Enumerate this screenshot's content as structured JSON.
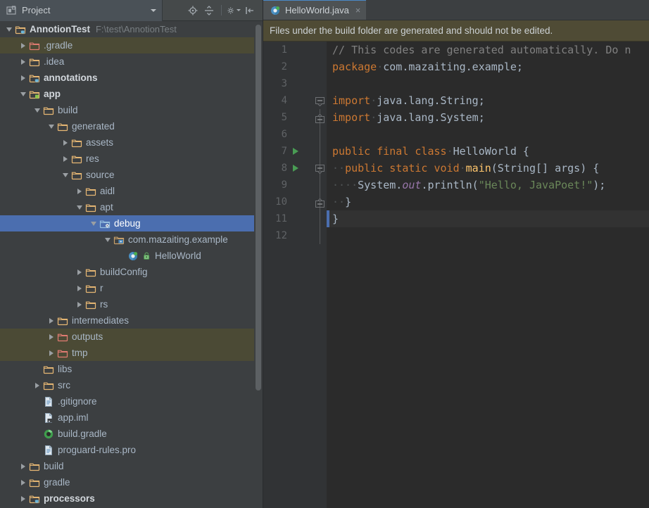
{
  "panel": {
    "title": "Project",
    "title_icon": "project-window-icon",
    "dropdown_icon": "chevron-down-icon",
    "tools": [
      {
        "name": "locate-in-tree-icon",
        "label": "Select Opened File"
      },
      {
        "name": "collapse-all-icon",
        "label": "Collapse All"
      },
      {
        "name": "settings-gear-icon",
        "label": "Settings"
      },
      {
        "name": "hide-panel-icon",
        "label": "Hide"
      }
    ]
  },
  "tree": {
    "rows": [
      {
        "depth": 0,
        "twisty": "expanded",
        "icon": "module-folder-icon",
        "label": "AnnotionTest",
        "sub": "F:\\test\\AnnotionTest",
        "bold": true,
        "state": "normal"
      },
      {
        "depth": 1,
        "twisty": "collapsed",
        "icon": "folder-red-icon",
        "label": ".gradle",
        "sub": "",
        "bold": false,
        "state": "excluded"
      },
      {
        "depth": 1,
        "twisty": "collapsed",
        "icon": "folder-icon",
        "label": ".idea",
        "sub": "",
        "bold": false,
        "state": "normal"
      },
      {
        "depth": 1,
        "twisty": "collapsed",
        "icon": "module-folder-icon",
        "label": "annotations",
        "sub": "",
        "bold": true,
        "state": "normal"
      },
      {
        "depth": 1,
        "twisty": "expanded",
        "icon": "android-module-icon",
        "label": "app",
        "sub": "",
        "bold": true,
        "state": "normal"
      },
      {
        "depth": 2,
        "twisty": "expanded",
        "icon": "folder-icon",
        "label": "build",
        "sub": "",
        "bold": false,
        "state": "normal"
      },
      {
        "depth": 3,
        "twisty": "expanded",
        "icon": "folder-icon",
        "label": "generated",
        "sub": "",
        "bold": false,
        "state": "normal"
      },
      {
        "depth": 4,
        "twisty": "collapsed",
        "icon": "folder-icon",
        "label": "assets",
        "sub": "",
        "bold": false,
        "state": "normal"
      },
      {
        "depth": 4,
        "twisty": "collapsed",
        "icon": "folder-icon",
        "label": "res",
        "sub": "",
        "bold": false,
        "state": "normal"
      },
      {
        "depth": 4,
        "twisty": "expanded",
        "icon": "folder-icon",
        "label": "source",
        "sub": "",
        "bold": false,
        "state": "normal"
      },
      {
        "depth": 5,
        "twisty": "collapsed",
        "icon": "folder-icon",
        "label": "aidl",
        "sub": "",
        "bold": false,
        "state": "normal"
      },
      {
        "depth": 5,
        "twisty": "expanded",
        "icon": "folder-icon",
        "label": "apt",
        "sub": "",
        "bold": false,
        "state": "normal"
      },
      {
        "depth": 6,
        "twisty": "expanded",
        "icon": "generated-source-folder-icon",
        "label": "debug",
        "sub": "",
        "bold": false,
        "state": "selected"
      },
      {
        "depth": 7,
        "twisty": "expanded",
        "icon": "package-icon",
        "label": "com.mazaiting.example",
        "sub": "",
        "bold": false,
        "state": "normal"
      },
      {
        "depth": 8,
        "twisty": "none",
        "icon": "java-class-icon",
        "icon2": "public-lock-icon",
        "label": "HelloWorld",
        "sub": "",
        "bold": false,
        "state": "normal"
      },
      {
        "depth": 5,
        "twisty": "collapsed",
        "icon": "folder-icon",
        "label": "buildConfig",
        "sub": "",
        "bold": false,
        "state": "normal"
      },
      {
        "depth": 5,
        "twisty": "collapsed",
        "icon": "folder-icon",
        "label": "r",
        "sub": "",
        "bold": false,
        "state": "normal"
      },
      {
        "depth": 5,
        "twisty": "collapsed",
        "icon": "folder-icon",
        "label": "rs",
        "sub": "",
        "bold": false,
        "state": "normal"
      },
      {
        "depth": 3,
        "twisty": "collapsed",
        "icon": "folder-icon",
        "label": "intermediates",
        "sub": "",
        "bold": false,
        "state": "normal"
      },
      {
        "depth": 3,
        "twisty": "collapsed",
        "icon": "folder-red-icon",
        "label": "outputs",
        "sub": "",
        "bold": false,
        "state": "excluded"
      },
      {
        "depth": 3,
        "twisty": "collapsed",
        "icon": "folder-red-icon",
        "label": "tmp",
        "sub": "",
        "bold": false,
        "state": "excluded"
      },
      {
        "depth": 2,
        "twisty": "none",
        "icon": "folder-icon",
        "label": "libs",
        "sub": "",
        "bold": false,
        "state": "normal"
      },
      {
        "depth": 2,
        "twisty": "collapsed",
        "icon": "folder-icon",
        "label": "src",
        "sub": "",
        "bold": false,
        "state": "normal"
      },
      {
        "depth": 2,
        "twisty": "none",
        "icon": "text-file-icon",
        "label": ".gitignore",
        "sub": "",
        "bold": false,
        "state": "normal"
      },
      {
        "depth": 2,
        "twisty": "none",
        "icon": "iml-file-icon",
        "label": "app.iml",
        "sub": "",
        "bold": false,
        "state": "normal"
      },
      {
        "depth": 2,
        "twisty": "none",
        "icon": "gradle-file-icon",
        "label": "build.gradle",
        "sub": "",
        "bold": false,
        "state": "normal"
      },
      {
        "depth": 2,
        "twisty": "none",
        "icon": "text-file-icon",
        "label": "proguard-rules.pro",
        "sub": "",
        "bold": false,
        "state": "normal"
      },
      {
        "depth": 1,
        "twisty": "collapsed",
        "icon": "folder-icon",
        "label": "build",
        "sub": "",
        "bold": false,
        "state": "normal"
      },
      {
        "depth": 1,
        "twisty": "collapsed",
        "icon": "folder-icon",
        "label": "gradle",
        "sub": "",
        "bold": false,
        "state": "normal"
      },
      {
        "depth": 1,
        "twisty": "collapsed",
        "icon": "module-folder-icon",
        "label": "processors",
        "sub": "",
        "bold": true,
        "state": "normal"
      }
    ]
  },
  "editor": {
    "tab": {
      "label": "HelloWorld.java",
      "icon": "java-class-icon",
      "close": "×"
    },
    "notification": "Files under the build folder are generated and should not be edited.",
    "line_numbers": [
      "1",
      "2",
      "3",
      "4",
      "5",
      "6",
      "7",
      "8",
      "9",
      "10",
      "11",
      "12"
    ],
    "run_arrow_lines": [
      7,
      8
    ],
    "current_line": 11,
    "lines": [
      {
        "n": 1,
        "tokens": [
          {
            "t": "// This codes are generated automatically. Do n",
            "c": "cm"
          }
        ]
      },
      {
        "n": 2,
        "tokens": [
          {
            "t": "package",
            "c": "kw"
          },
          {
            "t": " ",
            "c": "ws"
          },
          {
            "t": "com.mazaiting.example;",
            "c": ""
          }
        ]
      },
      {
        "n": 3,
        "tokens": []
      },
      {
        "n": 4,
        "tokens": [
          {
            "t": "import",
            "c": "kw"
          },
          {
            "t": " ",
            "c": "ws"
          },
          {
            "t": "java.lang.String;",
            "c": ""
          }
        ]
      },
      {
        "n": 5,
        "tokens": [
          {
            "t": "import",
            "c": "kw"
          },
          {
            "t": " ",
            "c": "ws"
          },
          {
            "t": "java.lang.System;",
            "c": ""
          }
        ]
      },
      {
        "n": 6,
        "tokens": []
      },
      {
        "n": 7,
        "tokens": [
          {
            "t": "public final class",
            "c": "kw"
          },
          {
            "t": " ",
            "c": "ws"
          },
          {
            "t": "HelloWorld {",
            "c": ""
          }
        ]
      },
      {
        "n": 8,
        "tokens": [
          {
            "t": "  ",
            "c": "ws"
          },
          {
            "t": "public static void",
            "c": "kw"
          },
          {
            "t": " ",
            "c": "ws"
          },
          {
            "t": "main",
            "c": "fn"
          },
          {
            "t": "(String[] args) {",
            "c": ""
          }
        ]
      },
      {
        "n": 9,
        "tokens": [
          {
            "t": "    ",
            "c": "ws"
          },
          {
            "t": "System.",
            "c": ""
          },
          {
            "t": "out",
            "c": "fld"
          },
          {
            "t": ".println(",
            "c": ""
          },
          {
            "t": "\"Hello, JavaPoet!\"",
            "c": "str"
          },
          {
            "t": ");",
            "c": ""
          }
        ]
      },
      {
        "n": 10,
        "tokens": [
          {
            "t": "  ",
            "c": "ws"
          },
          {
            "t": "}",
            "c": ""
          }
        ]
      },
      {
        "n": 11,
        "tokens": [
          {
            "t": "}",
            "c": ""
          }
        ]
      },
      {
        "n": 12,
        "tokens": []
      }
    ]
  },
  "colors": {
    "accent_blue": "#4b6eaf",
    "tab_active_border": "#4a88c7",
    "excluded_row": "#4b4a35",
    "notification_bg": "#4f4b35",
    "editor_bg": "#2b2b2b",
    "panel_bg": "#3c3f41",
    "keyword": "#cc7832",
    "string": "#6a8759",
    "comment": "#808080",
    "field": "#9876aa",
    "method": "#ffc66d",
    "run_green": "#499c54"
  }
}
